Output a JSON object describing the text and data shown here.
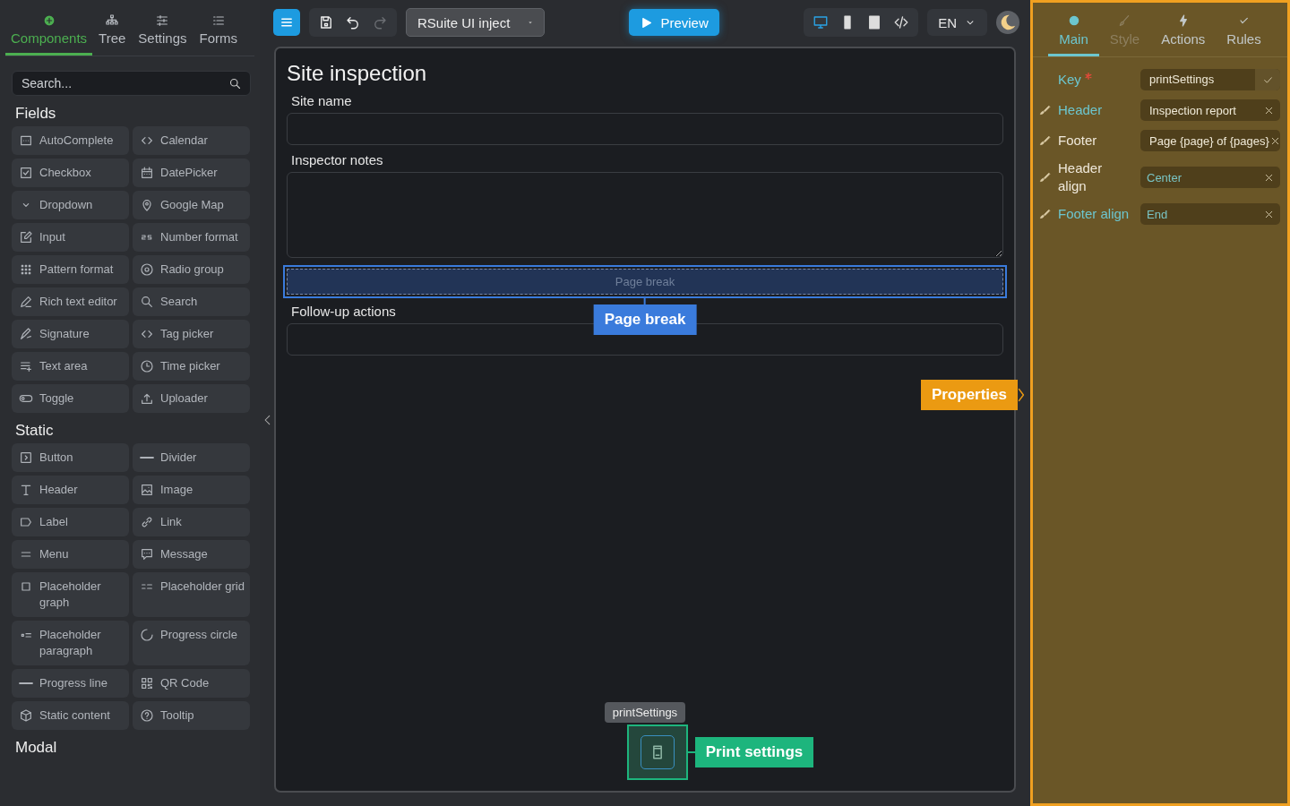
{
  "sidebar": {
    "tabs": [
      {
        "label": "Components",
        "selected": true
      },
      {
        "label": "Tree",
        "selected": false
      },
      {
        "label": "Settings",
        "selected": false
      },
      {
        "label": "Forms",
        "selected": false
      }
    ],
    "search": {
      "placeholder": "Search..."
    },
    "sections": [
      {
        "title": "Fields",
        "items": [
          "AutoComplete",
          "Calendar",
          "Checkbox",
          "DatePicker",
          "Dropdown",
          "Google Map",
          "Input",
          "Number format",
          "Pattern format",
          "Radio group",
          "Rich text editor",
          "Search",
          "Signature",
          "Tag picker",
          "Text area",
          "Time picker",
          "Toggle",
          "Uploader"
        ]
      },
      {
        "title": "Static",
        "items": [
          "Button",
          "Divider",
          "Header",
          "Image",
          "Label",
          "Link",
          "Menu",
          "Message",
          "Placeholder graph",
          "Placeholder grid",
          "Placeholder paragraph",
          "Progress circle",
          "Progress line",
          "QR Code",
          "Static content",
          "Tooltip"
        ]
      },
      {
        "title": "Modal"
      }
    ]
  },
  "toolbar": {
    "template": "RSuite UI inject",
    "preview": "Preview",
    "devices": [
      {
        "selected": true
      },
      {
        "selected": false
      },
      {
        "selected": false
      },
      {
        "selected": false
      }
    ],
    "language": "EN"
  },
  "form": {
    "title": "Site inspection",
    "fields": [
      {
        "kind": "input",
        "label": "Site name"
      },
      {
        "kind": "textarea",
        "label": "Inspector notes"
      },
      {
        "kind": "page_break",
        "text": "Page break",
        "selected": true,
        "callout": "Page break"
      },
      {
        "kind": "input",
        "label": "Follow-up actions"
      }
    ],
    "component": {
      "tooltip": "printSettings",
      "callout": "Print settings"
    },
    "properties_callout": "Properties"
  },
  "properties": {
    "tabs": [
      {
        "label": "Main",
        "selected": true,
        "disabled": false
      },
      {
        "label": "Style",
        "selected": false,
        "disabled": true
      },
      {
        "label": "Actions",
        "selected": false,
        "disabled": false
      },
      {
        "label": "Rules",
        "selected": false,
        "disabled": false
      }
    ],
    "rows": [
      {
        "kind": "key",
        "label": "Key",
        "required": true,
        "highlighted": true,
        "value": "printSettings"
      },
      {
        "kind": "input",
        "label": "Header",
        "required": false,
        "highlighted": true,
        "value": "Inspection report"
      },
      {
        "kind": "input",
        "label": "Footer",
        "required": false,
        "highlighted": false,
        "value": "Page {page} of {pages}"
      },
      {
        "kind": "select",
        "label": "Header align",
        "required": false,
        "highlighted": false,
        "value": "Center"
      },
      {
        "kind": "select",
        "label": "Footer align",
        "required": false,
        "highlighted": true,
        "value": "End"
      }
    ]
  }
}
